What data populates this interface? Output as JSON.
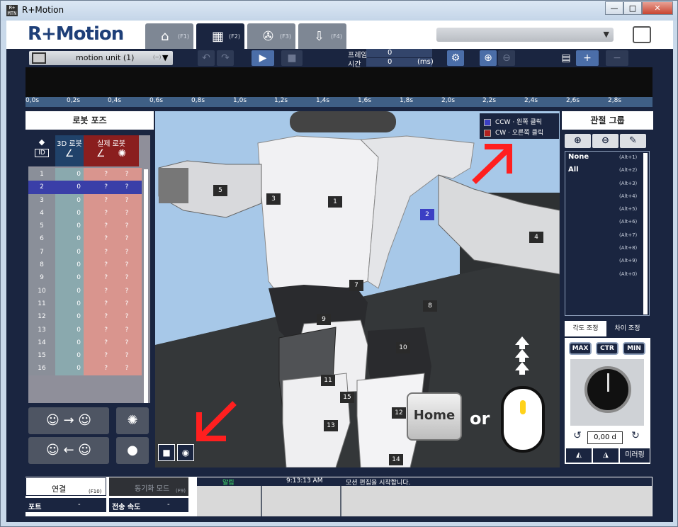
{
  "window": {
    "title": "R+Motion",
    "app_icon": "R+ MTN",
    "minimize": "—",
    "maximize": "□",
    "close": "✕"
  },
  "header": {
    "logo": "R+Motion",
    "tabs": [
      {
        "icon": "home-icon",
        "glyph": "⌂",
        "key": "(F1)"
      },
      {
        "icon": "film-icon",
        "glyph": "▦",
        "key": "(F2)"
      },
      {
        "icon": "reel-icon",
        "glyph": "✇",
        "key": "(F3)"
      },
      {
        "icon": "download-icon",
        "glyph": "⇩",
        "key": "(F4)"
      }
    ],
    "combo_value": ""
  },
  "toolbar": {
    "motion_unit": "motion unit (1)",
    "motion_unit_hotkey": "(~)",
    "frame_label": "프레임",
    "frame_value": "0",
    "time_label": "시간",
    "time_value": "0",
    "time_unit": "(ms)"
  },
  "timeline": {
    "ticks": [
      "0,0s",
      "0,2s",
      "0,4s",
      "0,6s",
      "0,8s",
      "1,0s",
      "1,2s",
      "1,4s",
      "1,6s",
      "1,8s",
      "2,0s",
      "2,2s",
      "2,4s",
      "2,6s",
      "2,8s"
    ]
  },
  "robot_pose": {
    "title": "로봇 포즈",
    "header_id": "ID",
    "header_3d": "3D 로봇",
    "header_real": "실제 로봇",
    "selected_id": 2,
    "rows": [
      {
        "id": "1",
        "v3d": "0",
        "r1": "?",
        "r2": "?"
      },
      {
        "id": "2",
        "v3d": "0",
        "r1": "?",
        "r2": "?"
      },
      {
        "id": "3",
        "v3d": "0",
        "r1": "?",
        "r2": "?"
      },
      {
        "id": "4",
        "v3d": "0",
        "r1": "?",
        "r2": "?"
      },
      {
        "id": "5",
        "v3d": "0",
        "r1": "?",
        "r2": "?"
      },
      {
        "id": "6",
        "v3d": "0",
        "r1": "?",
        "r2": "?"
      },
      {
        "id": "7",
        "v3d": "0",
        "r1": "?",
        "r2": "?"
      },
      {
        "id": "8",
        "v3d": "0",
        "r1": "?",
        "r2": "?"
      },
      {
        "id": "9",
        "v3d": "0",
        "r1": "?",
        "r2": "?"
      },
      {
        "id": "10",
        "v3d": "0",
        "r1": "?",
        "r2": "?"
      },
      {
        "id": "11",
        "v3d": "0",
        "r1": "?",
        "r2": "?"
      },
      {
        "id": "12",
        "v3d": "0",
        "r1": "?",
        "r2": "?"
      },
      {
        "id": "13",
        "v3d": "0",
        "r1": "?",
        "r2": "?"
      },
      {
        "id": "14",
        "v3d": "0",
        "r1": "?",
        "r2": "?"
      },
      {
        "id": "15",
        "v3d": "0",
        "r1": "?",
        "r2": "?"
      },
      {
        "id": "16",
        "v3d": "0",
        "r1": "?",
        "r2": "?"
      }
    ]
  },
  "viewport": {
    "legend_ccw": "CCW · 왼쪽 클릭",
    "legend_cw": "CW · 오른쪽 클릭",
    "ccw_color": "#3b3fc4",
    "cw_color": "#b02020",
    "home_key": "Home",
    "or_text": "or",
    "joint_labels": [
      "1",
      "2",
      "3",
      "4",
      "5",
      "7",
      "8",
      "9",
      "10",
      "11",
      "12",
      "13",
      "14",
      "15"
    ],
    "selected_joint": "2"
  },
  "joint_group": {
    "title": "관절 그룹",
    "items": [
      {
        "name": "None",
        "key": "(Alt+1)"
      },
      {
        "name": "All",
        "key": "(Alt+2)"
      },
      {
        "name": "",
        "key": "(Alt+3)"
      },
      {
        "name": "",
        "key": "(Alt+4)"
      },
      {
        "name": "",
        "key": "(Alt+5)"
      },
      {
        "name": "",
        "key": "(Alt+6)"
      },
      {
        "name": "",
        "key": "(Alt+7)"
      },
      {
        "name": "",
        "key": "(Alt+8)"
      },
      {
        "name": "",
        "key": "(Alt+9)"
      },
      {
        "name": "",
        "key": "(Alt+0)"
      }
    ]
  },
  "control": {
    "tab_angle": "각도 조정",
    "tab_diff": "차이 조정",
    "max": "MAX",
    "ctr": "CTR",
    "min": "MIN",
    "angle_value": "0,00 d",
    "mirror": "미러링"
  },
  "status": {
    "connect": "연결",
    "connect_key": "(F10)",
    "sync_mode": "동기화 모드",
    "sync_key": "(F9)",
    "port_label": "포트",
    "port_value": "-",
    "speed_label": "전송 속도",
    "speed_value": "-",
    "log_header_alert": "알림",
    "log_time": "9:13:13 AM",
    "log_message": "모션 편집을 시작합니다."
  }
}
